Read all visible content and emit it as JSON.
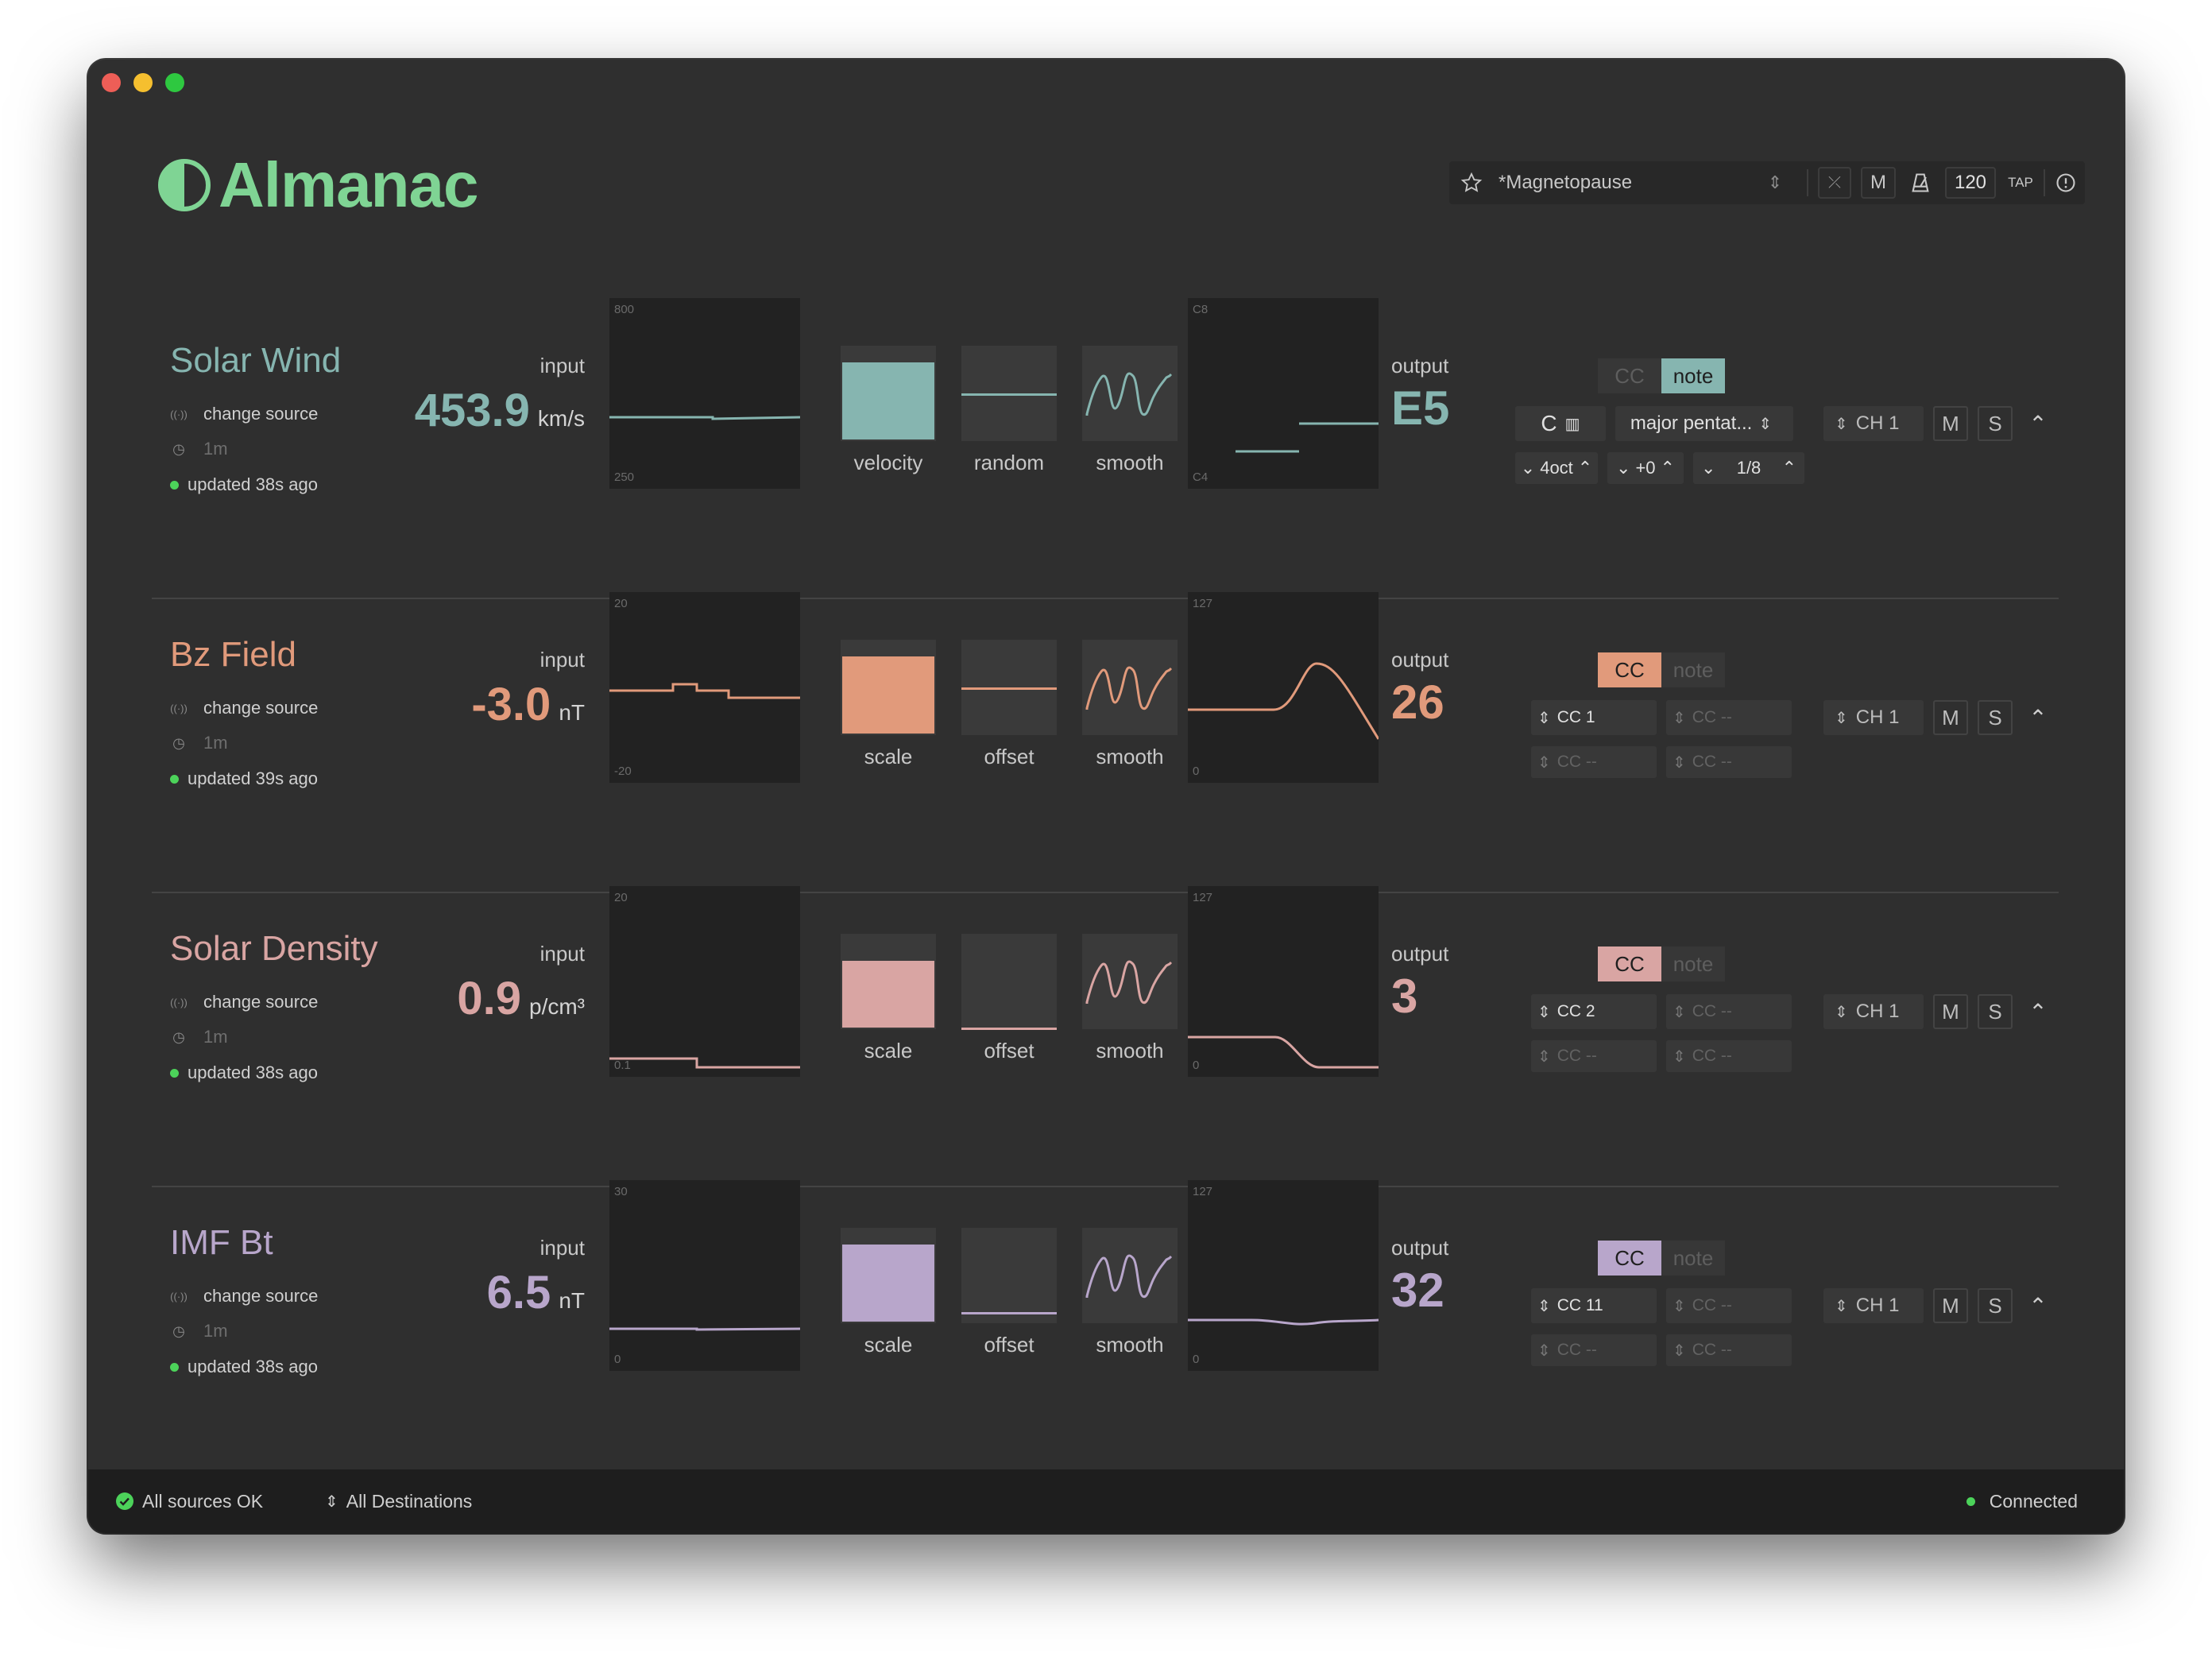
{
  "app": {
    "title": "Almanac"
  },
  "toolbar": {
    "preset_name": "*Magnetopause",
    "m_label": "M",
    "bpm": "120",
    "tap_label": "TAP"
  },
  "rows": [
    {
      "name": "Solar Wind",
      "color": "#86b5b0",
      "change_source": "change source",
      "interval": "1m",
      "updated": "updated 38s ago",
      "input_label": "input",
      "input_value": "453.9",
      "input_unit": "km/s",
      "in_top": "800",
      "in_bot": "250",
      "modulators": [
        "velocity",
        "random",
        "smooth"
      ],
      "output_label": "output",
      "output_value": "E5",
      "out_top": "C8",
      "out_bot": "C4",
      "mode_cc": "CC",
      "mode_note": "note",
      "mode_active": "note",
      "note_root": "C",
      "scale": "major pentat...",
      "octave": "4oct",
      "transpose": "+0",
      "division": "1/8",
      "channel": "CH 1",
      "mute": "M",
      "solo": "S"
    },
    {
      "name": "Bz Field",
      "color": "#e19a7b",
      "change_source": "change source",
      "interval": "1m",
      "updated": "updated 39s ago",
      "input_label": "input",
      "input_value": "-3.0",
      "input_unit": "nT",
      "in_top": "20",
      "in_bot": "-20",
      "modulators": [
        "scale",
        "offset",
        "smooth"
      ],
      "output_label": "output",
      "output_value": "26",
      "out_top": "127",
      "out_bot": "0",
      "mode_cc": "CC",
      "mode_note": "note",
      "mode_active": "CC",
      "cc_slots": [
        "CC 1",
        "CC --",
        "CC --",
        "CC --"
      ],
      "channel": "CH 1",
      "mute": "M",
      "solo": "S"
    },
    {
      "name": "Solar Density",
      "color": "#d9a5a3",
      "change_source": "change source",
      "interval": "1m",
      "updated": "updated 38s ago",
      "input_label": "input",
      "input_value": "0.9",
      "input_unit": "p/cm³",
      "in_top": "20",
      "in_bot": "0.1",
      "modulators": [
        "scale",
        "offset",
        "smooth"
      ],
      "output_label": "output",
      "output_value": "3",
      "out_top": "127",
      "out_bot": "0",
      "mode_cc": "CC",
      "mode_note": "note",
      "mode_active": "CC",
      "cc_slots": [
        "CC 2",
        "CC --",
        "CC --",
        "CC --"
      ],
      "channel": "CH 1",
      "mute": "M",
      "solo": "S"
    },
    {
      "name": "IMF Bt",
      "color": "#b8a6cb",
      "change_source": "change source",
      "interval": "1m",
      "updated": "updated 38s ago",
      "input_label": "input",
      "input_value": "6.5",
      "input_unit": "nT",
      "in_top": "30",
      "in_bot": "0",
      "modulators": [
        "scale",
        "offset",
        "smooth"
      ],
      "output_label": "output",
      "output_value": "32",
      "out_top": "127",
      "out_bot": "0",
      "mode_cc": "CC",
      "mode_note": "note",
      "mode_active": "CC",
      "cc_slots": [
        "CC 11",
        "CC --",
        "CC --",
        "CC --"
      ],
      "channel": "CH 1",
      "mute": "M",
      "solo": "S"
    }
  ],
  "status": {
    "sources": "All sources OK",
    "destinations": "All Destinations",
    "connection": "Connected"
  }
}
